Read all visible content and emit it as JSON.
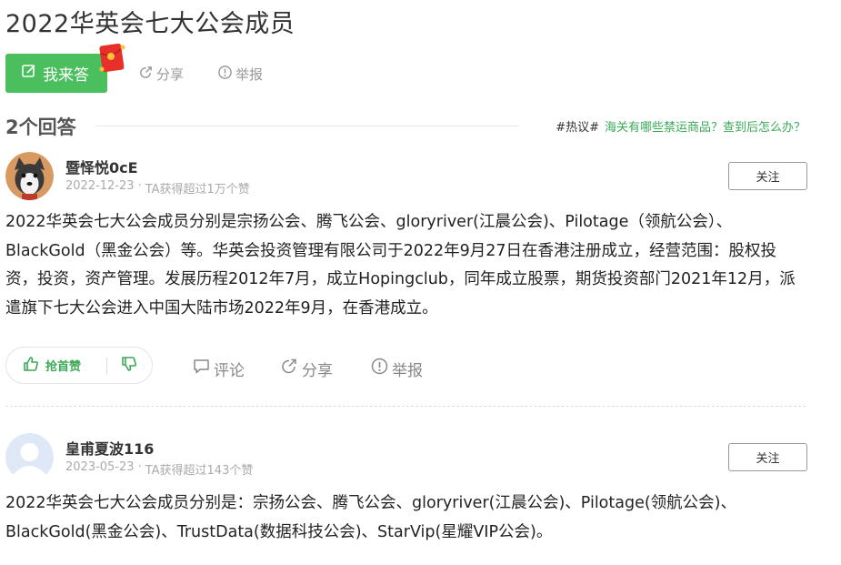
{
  "page": {
    "title": "2022华英会七大公会成员"
  },
  "actions": {
    "answer_label": "我来答",
    "share_label": "分享",
    "report_label": "举报"
  },
  "answers_header": {
    "count_label": "2个回答",
    "hot_tag": "#热议#",
    "hot_link": "海关有哪些禁运商品？查到后怎么办？"
  },
  "answers": [
    {
      "user_name": "暨怿悦0cE",
      "date": "2022-12-23",
      "stat": "TA获得超过1万个赞",
      "follow_label": "关注",
      "body": "2022华英会七大公会成员分别是宗扬公会、腾飞公会、gloryriver(江晨公会)、Pilotage（领航公会）、BlackGold（黑金公会）等。华英会投资管理有限公司于2022年9月27日在香港注册成立，经营范围：股权投资，投资，资产管理。发展历程2012年7月，成立Hopingclub，同年成立股票，期货投资部门2021年12月，派遣旗下七大公会进入中国大陆市场2022年9月，在香港成立。",
      "upvote_label": "抢首赞",
      "comment_label": "评论",
      "share_label": "分享",
      "report_label": "举报"
    },
    {
      "user_name": "皇甫夏波116",
      "date": "2023-05-23",
      "stat": "TA获得超过143个赞",
      "follow_label": "关注",
      "body": "2022华英会七大公会成员分别是：宗扬公会、腾飞公会、gloryriver(江晨公会)、Pilotage(领航公会)、BlackGold(黑金公会)、TrustData(数据科技公会)、StarVip(星耀VIP公会)。"
    }
  ],
  "colors": {
    "accent_green": "#4bbf5d",
    "link_green": "#3aa956"
  },
  "icons": [
    "edit-icon",
    "red-packet-icon",
    "share-icon",
    "report-icon",
    "thumb-up-icon",
    "thumb-down-icon",
    "comment-icon"
  ]
}
